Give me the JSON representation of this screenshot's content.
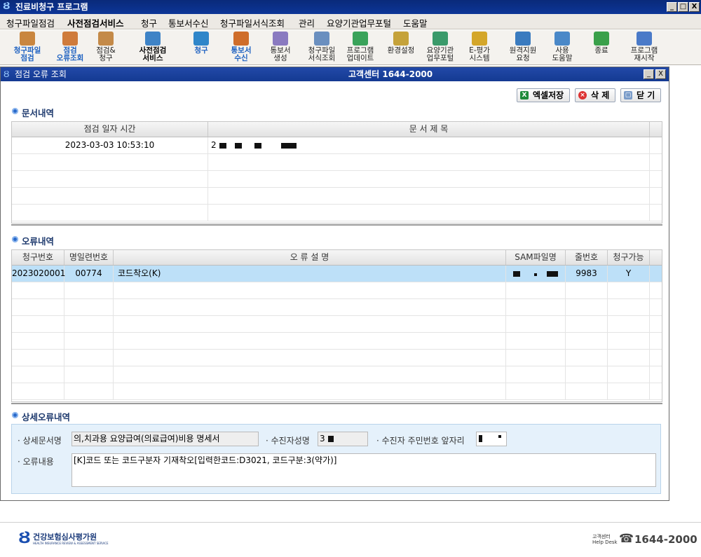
{
  "window": {
    "title": "진료비청구 프로그램",
    "min": "_",
    "max": "□",
    "close": "X"
  },
  "menu": [
    "청구파일점검",
    "사전점검서비스",
    "청구",
    "통보서수신",
    "청구파일서식조회",
    "관리",
    "요양기관업무포털",
    "도움말"
  ],
  "toolbar": [
    {
      "label": "청구파일\n점검",
      "icon": "folder-check-icon",
      "style": "blue"
    },
    {
      "label": "점검\n오류조회",
      "icon": "error-search-icon",
      "style": "blue"
    },
    {
      "label": "점검&\n청구",
      "icon": "check-claim-icon",
      "style": "normal"
    },
    {
      "label": "사전점검\n서비스",
      "icon": "precheck-service-icon",
      "style": "bold"
    },
    {
      "label": "청구",
      "icon": "claim-icon",
      "style": "blue"
    },
    {
      "label": "통보서\n수신",
      "icon": "receive-notice-icon",
      "style": "blue"
    },
    {
      "label": "통보서\n생성",
      "icon": "create-notice-icon",
      "style": "normal"
    },
    {
      "label": "청구파일\n서식조회",
      "icon": "form-search-icon",
      "style": "normal"
    },
    {
      "label": "프로그램\n업데이트",
      "icon": "update-icon",
      "style": "normal"
    },
    {
      "label": "환경설정",
      "icon": "settings-icon",
      "style": "normal"
    },
    {
      "label": "요양기관\n업무포털",
      "icon": "portal-icon",
      "style": "normal"
    },
    {
      "label": "E-평가\n시스템",
      "icon": "trophy-icon",
      "style": "normal"
    },
    {
      "label": "원격지원\n요청",
      "icon": "remote-support-icon",
      "style": "normal"
    },
    {
      "label": "사용\n도움말",
      "icon": "help-icon",
      "style": "normal"
    },
    {
      "label": "종료",
      "icon": "exit-icon",
      "style": "normal"
    },
    {
      "label": "프로그램\n재시작",
      "icon": "restart-icon",
      "style": "normal"
    }
  ],
  "panel": {
    "title": "점검 오류 조회",
    "center": "고객센터 1644-2000",
    "excel": "엑셀저장",
    "delete": "삭 제",
    "close": "닫 기"
  },
  "doc": {
    "section": "문서내역",
    "headers": [
      "점검 일자 시간",
      "문 서 제 목"
    ],
    "rows": [
      [
        "2023-03-03 10:53:10",
        "2"
      ]
    ]
  },
  "err": {
    "section": "오류내역",
    "headers": [
      "청구번호",
      "명일련번호",
      "오 류 설 명",
      "SAM파일명",
      "줄번호",
      "청구가능"
    ],
    "rows": [
      [
        "2023020001",
        "00774",
        "코드착오(K)",
        "",
        "9983",
        "Y"
      ]
    ]
  },
  "detail": {
    "section": "상세오류내역",
    "doc_label": "상세문서명",
    "doc_value": "의,치과용 요양급여(의료급여)비용 명세서",
    "name_label": "수진자성명",
    "name_value": "3",
    "rrn_label": "수진자 주민번호 앞자리",
    "rrn_value": "",
    "content_label": "오류내용",
    "content_value": "[K]코드 또는 코드구분자 기재착오[입력한코드:D3021, 코드구분:3(약가)]"
  },
  "footer": {
    "org": "건강보험심사평가원",
    "org_sub": "HEALTH INSURANCE REVIEW & ASSESSMENT SERVICE",
    "helpdesk_top": "고객센터",
    "helpdesk_bot": "Help Desk",
    "phone": "1644-2000"
  }
}
